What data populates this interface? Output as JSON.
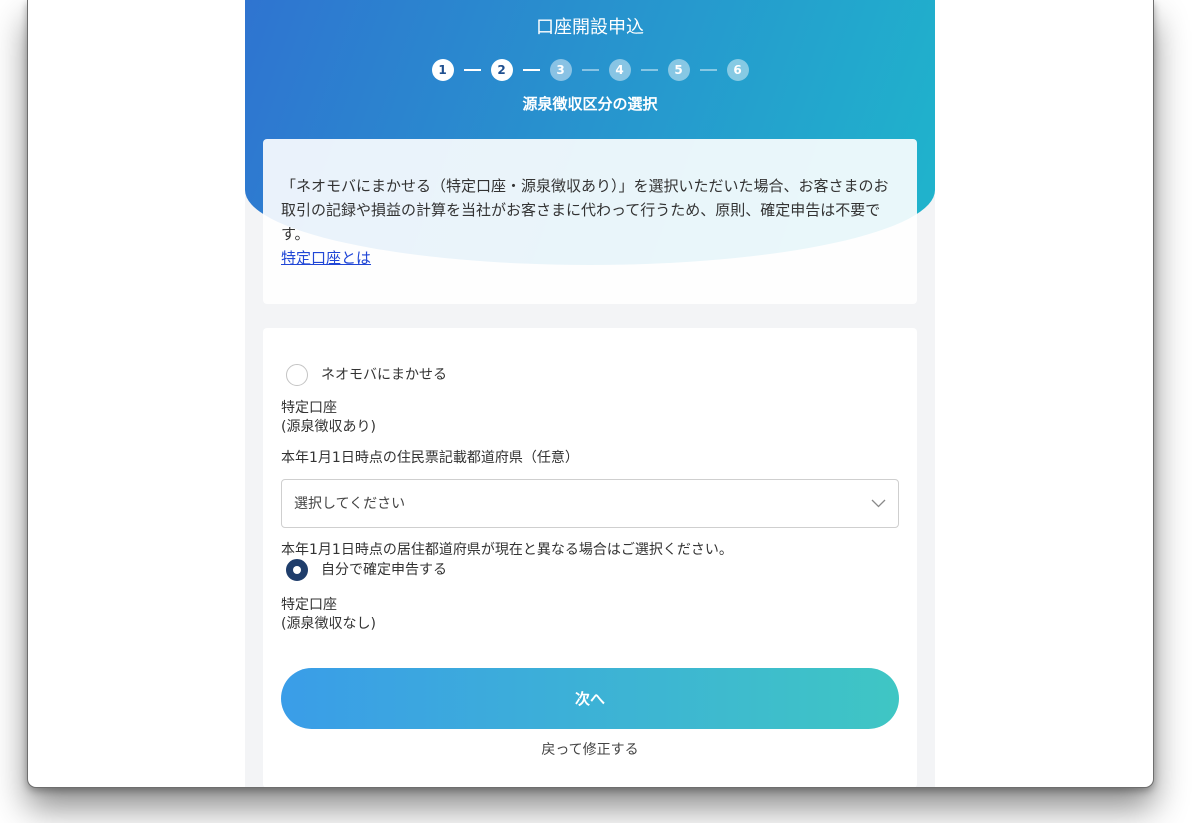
{
  "header": {
    "title": "口座開設申込",
    "steps": [
      {
        "number": "1",
        "active": true
      },
      {
        "number": "2",
        "active": true
      },
      {
        "number": "3",
        "active": false
      },
      {
        "number": "4",
        "active": false
      },
      {
        "number": "5",
        "active": false
      },
      {
        "number": "6",
        "active": false
      }
    ],
    "subtitle": "源泉徴収区分の選択"
  },
  "info_card": {
    "text": "「ネオモバにまかせる（特定口座・源泉徴収あり）」を選択いただいた場合、お客さまのお取引の記録や損益の計算を当社がお客さまに代わって行うため、原則、確定申告は不要です。",
    "link_label": "特定口座とは"
  },
  "form": {
    "options": [
      {
        "label": "ネオモバにまかせる",
        "selected": false,
        "account_type": "特定口座",
        "withholding": "(源泉徴収あり)",
        "prefecture": {
          "label": "本年1月1日時点の住民票記載都道府県（任意）",
          "placeholder": "選択してください",
          "note": "本年1月1日時点の居住都道府県が現在と異なる場合はご選択ください。"
        }
      },
      {
        "label": "自分で確定申告する",
        "selected": true,
        "account_type": "特定口座",
        "withholding": "(源泉徴収なし)"
      }
    ],
    "next_button_label": "次へ",
    "back_link_label": "戻って修正する"
  },
  "icons": {
    "select_arrow": "chevron-down-icon"
  },
  "colors": {
    "header_gradient_start": "#2f74d0",
    "header_gradient_end": "#1fb5cc",
    "button_gradient_start": "#3a9de8",
    "button_gradient_end": "#3fc6c4",
    "radio_selected": "#1f3d6b",
    "link": "#2046d6",
    "page_background": "#f3f4f6"
  }
}
